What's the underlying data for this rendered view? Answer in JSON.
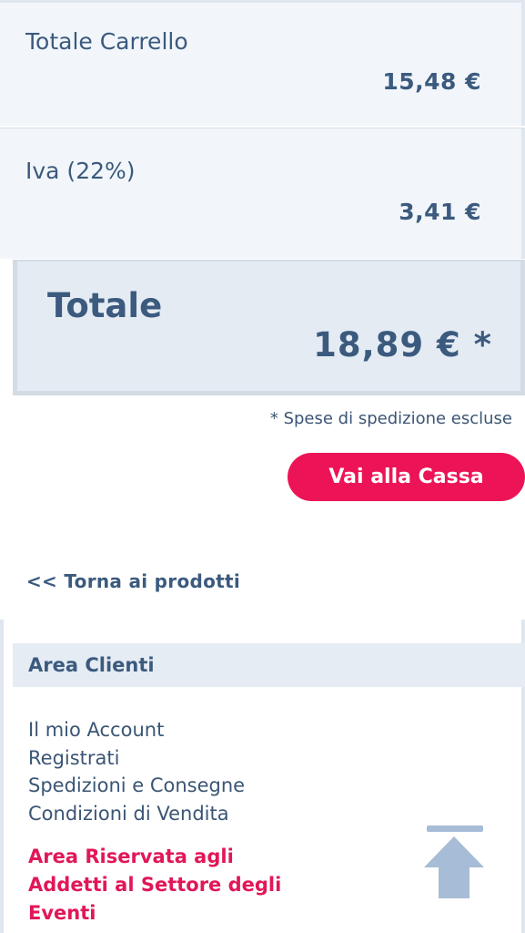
{
  "cart": {
    "subtotal_label": "Totale Carrello",
    "subtotal_value": "15,48 €",
    "vat_label": "Iva (22%)",
    "vat_value": "3,41 €",
    "total_label": "Totale",
    "total_value": "18,89 € *",
    "shipping_note": "* Spese di spedizione escluse",
    "checkout_label": "Vai alla Cassa",
    "back_link": "<< Torna ai prodotti"
  },
  "customer_area": {
    "title": "Area Clienti",
    "links": [
      "Il mio Account",
      "Registrati",
      "Spedizioni e Consegne",
      "Condizioni di Vendita"
    ],
    "reserved_lines": [
      "Area Riservata agli",
      "Addetti al Settore degli",
      "Eventi"
    ]
  },
  "colors": {
    "primary_text": "#3b5a7e",
    "accent": "#ec1456",
    "panel_bg": "#f2f6fa",
    "total_bg": "#e4ebf3"
  },
  "icons": {
    "back_to_top": "arrow-up-icon"
  }
}
